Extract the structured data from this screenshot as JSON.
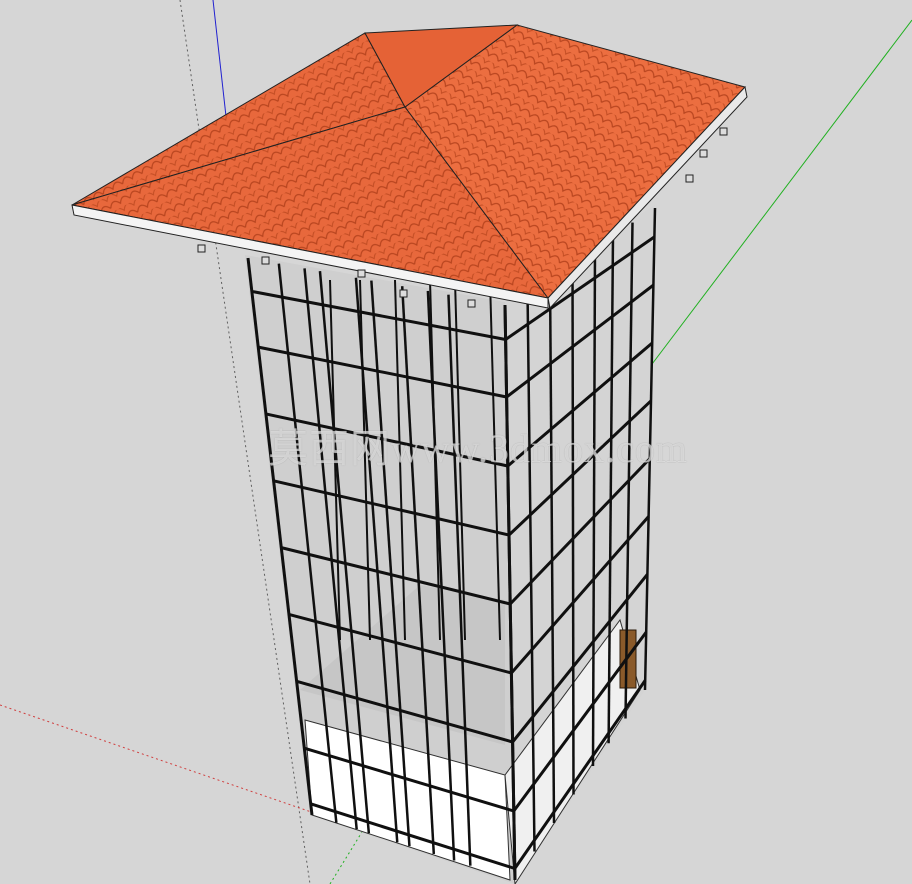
{
  "viewport": {
    "background": "#d6d6d6",
    "watermark": "莫西网www.3dmox.com"
  },
  "model": {
    "roof_color": "#e8683c",
    "roof_shade": "#d2562b",
    "fascia_color": "#f2f2f2",
    "frame_color": "#101010",
    "wall_color": "#ffffff",
    "floor_color": "#c9c9c9"
  },
  "axes": {
    "red": "#d04040",
    "green": "#20b020",
    "blue": "#2020d0"
  }
}
